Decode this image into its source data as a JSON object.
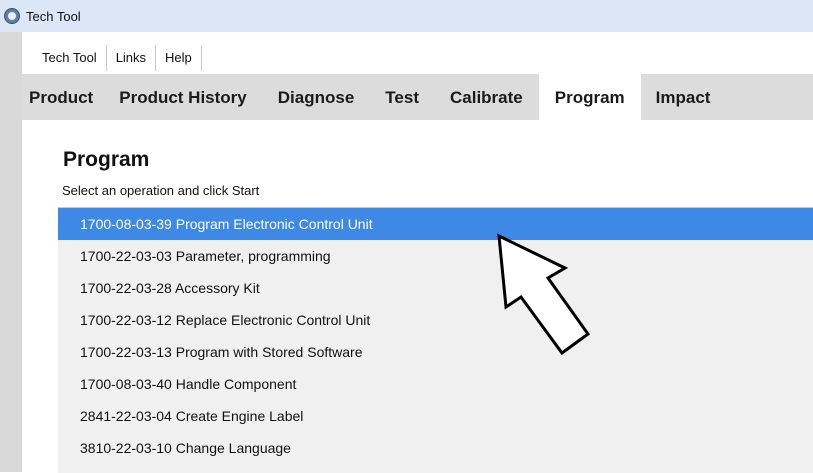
{
  "window": {
    "title": "Tech Tool"
  },
  "menubar": {
    "items": [
      "Tech Tool",
      "Links",
      "Help"
    ]
  },
  "tabs": [
    "Product",
    "Product History",
    "Diagnose",
    "Test",
    "Calibrate",
    "Program",
    "Impact"
  ],
  "active_tab": "Program",
  "page": {
    "title": "Program",
    "subtitle": "Select an operation and click Start"
  },
  "operations": [
    "1700-08-03-39 Program Electronic Control Unit",
    "1700-22-03-03 Parameter, programming",
    "1700-22-03-28 Accessory Kit",
    "1700-22-03-12 Replace Electronic Control Unit",
    "1700-22-03-13 Program with Stored Software",
    "1700-08-03-40 Handle Component",
    "2841-22-03-04 Create Engine Label",
    "3810-22-03-10 Change Language"
  ],
  "selected_operation": "1700-08-03-39 Program Electronic Control Unit",
  "colors": {
    "selection": "#3e88e6",
    "titlebar": "#dbe7f7",
    "tabbar": "#dcdcdc",
    "list_background": "#f0f0f0"
  },
  "icons": {
    "app": "tech-tool-logo-icon",
    "callout": "pointer-arrow-icon"
  }
}
